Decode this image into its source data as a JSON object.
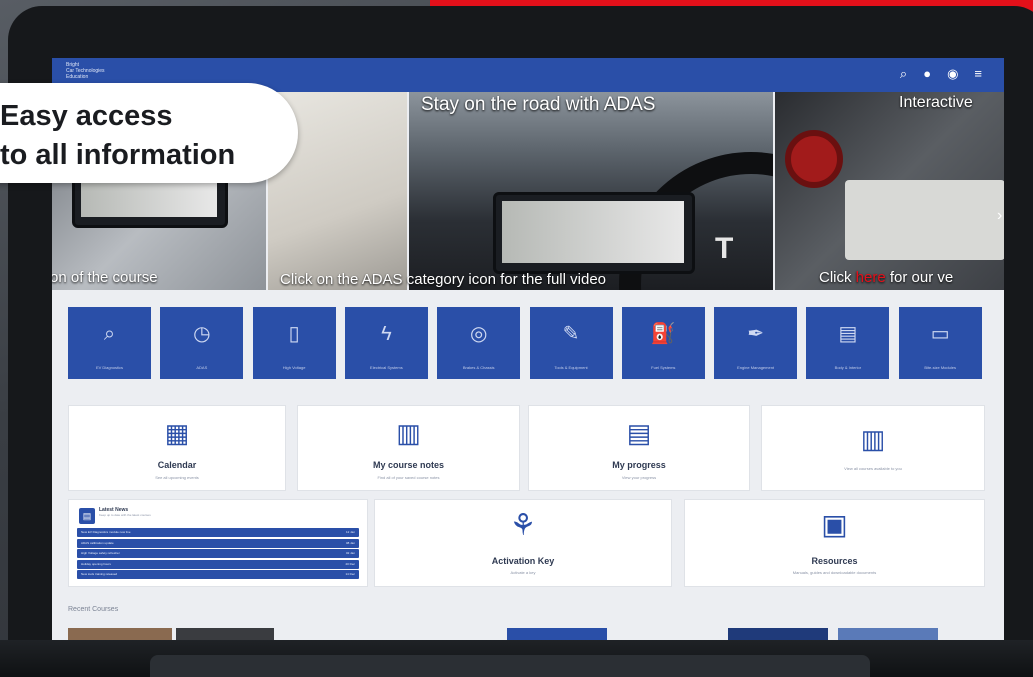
{
  "callout": {
    "line1": "Easy access",
    "line2": "to all information"
  },
  "header": {
    "brand_line1": "Bright",
    "brand_line2": "Car Technologies",
    "brand_line3": "Education"
  },
  "nav_icons": [
    "search-icon",
    "chat-icon",
    "user-icon",
    "menu-icon"
  ],
  "banners": [
    {
      "title": "",
      "caption": "on of the course"
    },
    {
      "title": "",
      "caption": "Click on the ADAS category icon for the full video"
    },
    {
      "title": "Stay on the road with ADAS",
      "caption": ""
    },
    {
      "title": "Interactive",
      "caption_pre": "Click",
      "caption_highlight": "here",
      "caption_post": "for our ve"
    }
  ],
  "categories": [
    {
      "icon": "diagnostics-icon",
      "glyph": "⌕",
      "label": "EV Diagnostics"
    },
    {
      "icon": "adas-icon",
      "glyph": "◷",
      "label": "ADAS"
    },
    {
      "icon": "battery-icon",
      "glyph": "▯",
      "label": "High Voltage"
    },
    {
      "icon": "electrical-icon",
      "glyph": "ϟ",
      "label": "Electrical Systems"
    },
    {
      "icon": "brakes-icon",
      "glyph": "◎",
      "label": "Brakes & Chassis"
    },
    {
      "icon": "tools-icon",
      "glyph": "✎",
      "label": "Tools & Equipment"
    },
    {
      "icon": "fuel-icon",
      "glyph": "⛽",
      "label": "Fuel Systems"
    },
    {
      "icon": "pen-icon",
      "glyph": "✒",
      "label": "Engine Management"
    },
    {
      "icon": "document-icon",
      "glyph": "▤",
      "label": "Body & Interior"
    },
    {
      "icon": "id-card-icon",
      "glyph": "▭",
      "label": "Bite-size Modules"
    }
  ],
  "cards": {
    "calendar": {
      "title": "Calendar",
      "subtitle": "See all upcoming events"
    },
    "notes": {
      "title": "My course notes",
      "subtitle": "Find all of your saved course notes"
    },
    "progress": {
      "title": "My progress",
      "subtitle": "View your progress"
    },
    "courses": {
      "title": "",
      "subtitle": "View all courses available to you"
    },
    "activation": {
      "title": "Activation Key",
      "subtitle": "Activate a key"
    },
    "resources": {
      "title": "Resources",
      "subtitle": "Manuals, guides and downloadable documents"
    }
  },
  "news": {
    "title": "Latest News",
    "subtitle": "Keep up to date with the latest courses",
    "items": [
      {
        "text": "New EV Diagnostics module now live",
        "date": "12 Jan"
      },
      {
        "text": "ADAS calibration update",
        "date": "08 Jan"
      },
      {
        "text": "High Voltage safety refresher",
        "date": "02 Jan"
      },
      {
        "text": "Holiday opening hours",
        "date": "20 Dec"
      },
      {
        "text": "New tools training released",
        "date": "14 Dec"
      }
    ]
  },
  "section": {
    "label": "Recent Courses"
  },
  "colors": {
    "brand_blue": "#2a4fa8",
    "accent_red": "#e3101a"
  }
}
